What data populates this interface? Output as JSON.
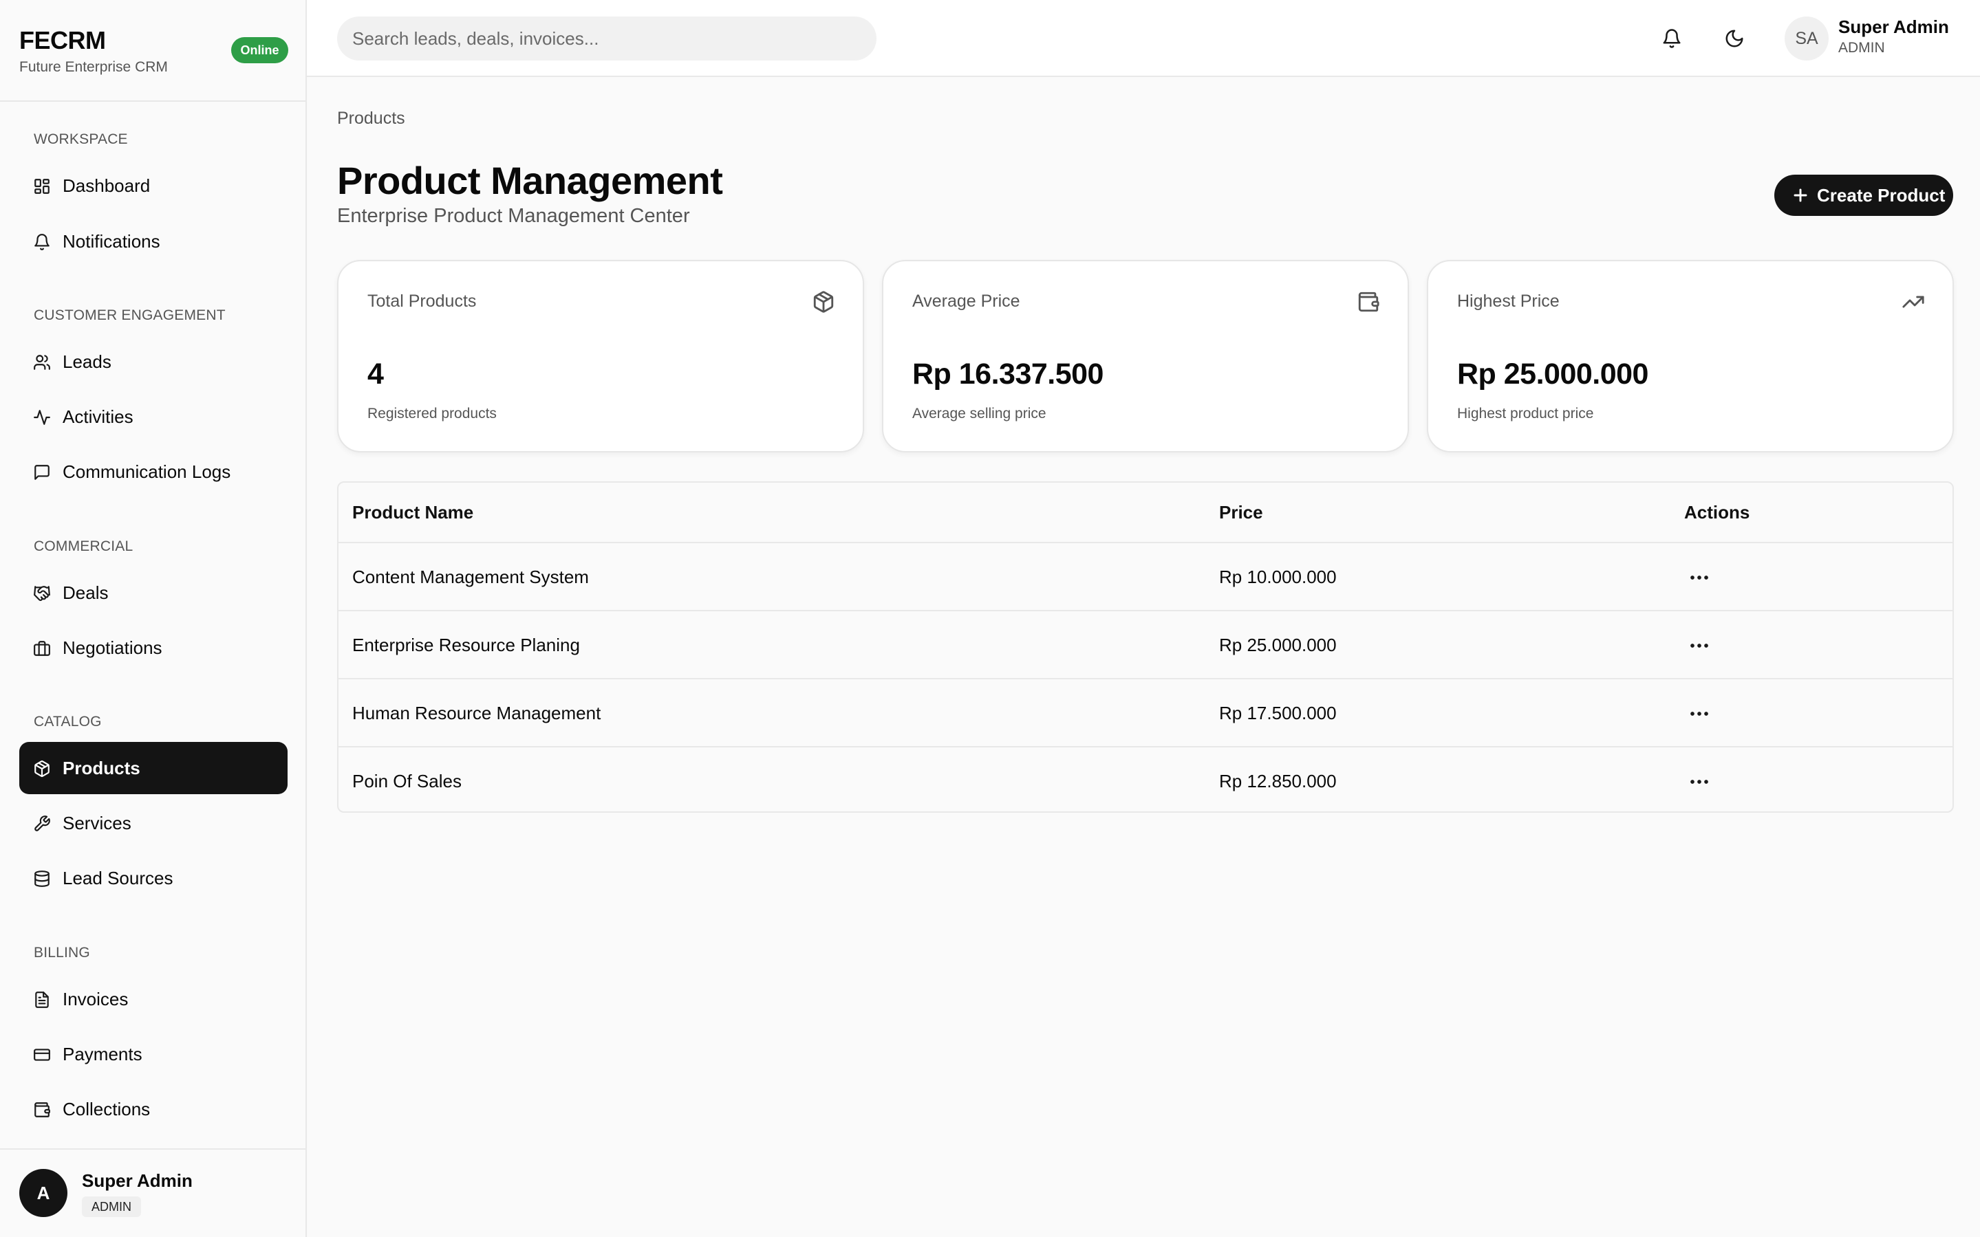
{
  "brand": {
    "title": "FECRM",
    "subtitle": "Future Enterprise CRM",
    "status": "Online"
  },
  "sidebar": {
    "sections": [
      {
        "label": "WORKSPACE",
        "items": [
          {
            "label": "Dashboard",
            "icon": "dashboard-icon"
          },
          {
            "label": "Notifications",
            "icon": "bell-icon"
          }
        ]
      },
      {
        "label": "CUSTOMER ENGAGEMENT",
        "items": [
          {
            "label": "Leads",
            "icon": "users-icon"
          },
          {
            "label": "Activities",
            "icon": "activity-icon"
          },
          {
            "label": "Communication Logs",
            "icon": "message-icon"
          }
        ]
      },
      {
        "label": "COMMERCIAL",
        "items": [
          {
            "label": "Deals",
            "icon": "handshake-icon"
          },
          {
            "label": "Negotiations",
            "icon": "briefcase-icon"
          }
        ]
      },
      {
        "label": "CATALOG",
        "items": [
          {
            "label": "Products",
            "icon": "package-icon",
            "active": true
          },
          {
            "label": "Services",
            "icon": "wrench-icon"
          },
          {
            "label": "Lead Sources",
            "icon": "database-icon"
          }
        ]
      },
      {
        "label": "BILLING",
        "items": [
          {
            "label": "Invoices",
            "icon": "file-text-icon"
          },
          {
            "label": "Payments",
            "icon": "credit-card-icon"
          },
          {
            "label": "Collections",
            "icon": "wallet-icon"
          }
        ]
      }
    ],
    "user": {
      "initial": "A",
      "name": "Super Admin",
      "role": "ADMIN"
    }
  },
  "topbar": {
    "search_placeholder": "Search leads, deals, invoices...",
    "user": {
      "initials": "SA",
      "name": "Super Admin",
      "role": "ADMIN"
    }
  },
  "page": {
    "breadcrumb": "Products",
    "title": "Product Management",
    "subtitle": "Enterprise Product Management Center",
    "create_label": "Create Product"
  },
  "stats": [
    {
      "label": "Total Products",
      "value": "4",
      "desc": "Registered products",
      "icon": "package-icon"
    },
    {
      "label": "Average Price",
      "value": "Rp 16.337.500",
      "desc": "Average selling price",
      "icon": "wallet-icon"
    },
    {
      "label": "Highest Price",
      "value": "Rp 25.000.000",
      "desc": "Highest product price",
      "icon": "trending-up-icon"
    }
  ],
  "table": {
    "columns": [
      "Product Name",
      "Price",
      "Actions"
    ],
    "rows": [
      {
        "name": "Content Management System",
        "price": "Rp 10.000.000"
      },
      {
        "name": "Enterprise Resource Planing",
        "price": "Rp 25.000.000"
      },
      {
        "name": "Human Resource Management",
        "price": "Rp 17.500.000"
      },
      {
        "name": "Poin Of Sales",
        "price": "Rp 12.850.000"
      }
    ]
  },
  "colors": {
    "primary": "#141414",
    "online": "#2e9e47",
    "muted": "#555555",
    "border": "#e8e8e8"
  }
}
